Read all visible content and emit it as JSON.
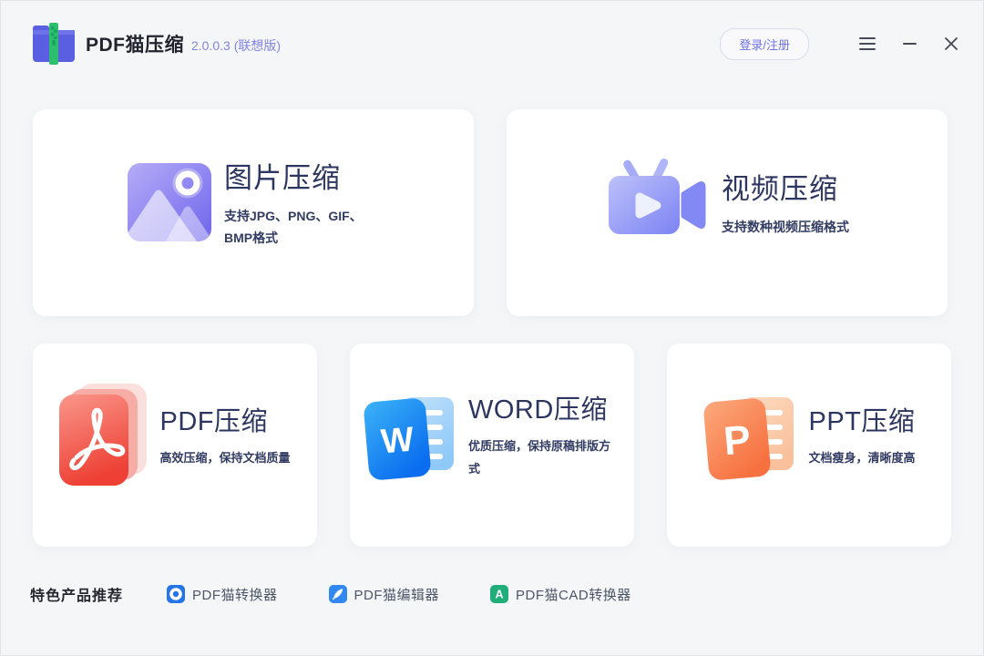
{
  "header": {
    "app_title": "PDF猫压缩",
    "version": "2.0.0.3 (联想版)",
    "login_label": "登录/注册"
  },
  "cards_row1": [
    {
      "id": "image-compress",
      "title": "图片压缩",
      "subtitle": "支持JPG、PNG、GIF、BMP格式"
    },
    {
      "id": "video-compress",
      "title": "视频压缩",
      "subtitle": "支持数种视频压缩格式"
    }
  ],
  "cards_row2": [
    {
      "id": "pdf-compress",
      "title": "PDF压缩",
      "subtitle": "高效压缩，保持文档质量"
    },
    {
      "id": "word-compress",
      "title": "WORD压缩",
      "subtitle": "优质压缩，保持原稿排版方式",
      "letter": "W"
    },
    {
      "id": "ppt-compress",
      "title": "PPT压缩",
      "subtitle": "文档瘦身，清晰度高",
      "letter": "P"
    }
  ],
  "footer": {
    "label": "特色产品推荐",
    "links": [
      {
        "name": "PDF猫转换器"
      },
      {
        "name": "PDF猫编辑器"
      },
      {
        "name": "PDF猫CAD转换器"
      }
    ],
    "cad_letter": "A"
  },
  "colors": {
    "background": "#f5f6f8",
    "card_bg": "#ffffff",
    "accent_indigo": "#5a5fe2",
    "zipper_green": "#2cc06e",
    "title_navy": "#2d3661",
    "version_purple": "#8185dd",
    "login_purple": "#6d72e4",
    "pdf_red": "#ee4437",
    "word_blue": "#0a6def",
    "ppt_orange": "#f7703f",
    "link_blue": "#2574ea",
    "cad_green": "#1fad7a"
  }
}
